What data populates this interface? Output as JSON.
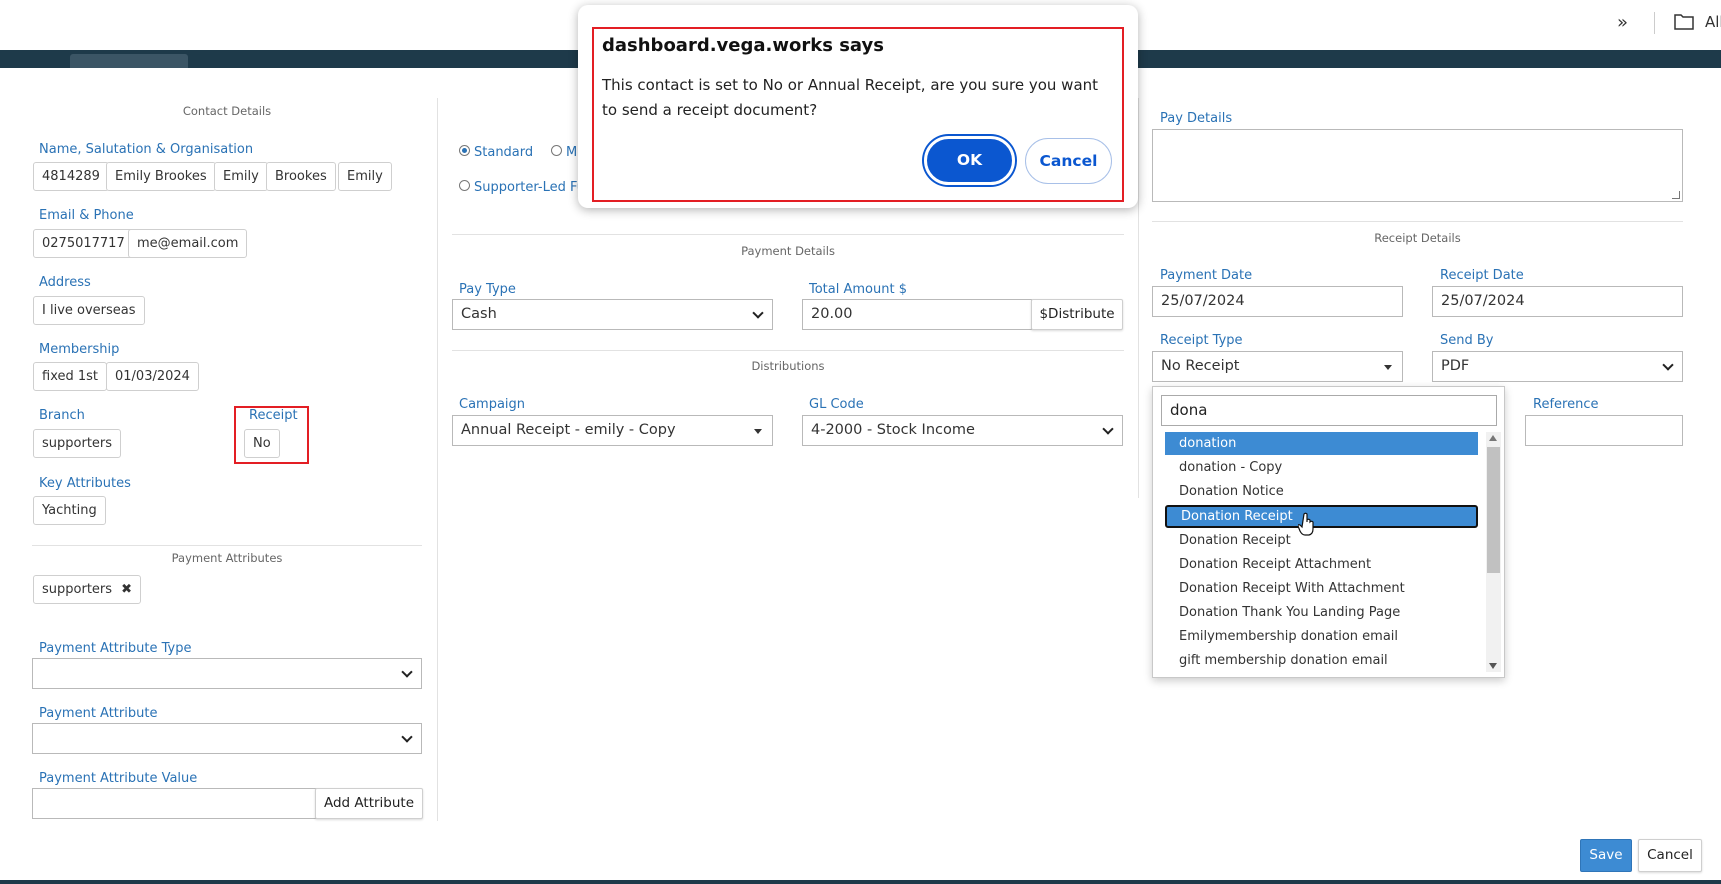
{
  "toolbar": {
    "label": "All"
  },
  "contact": {
    "section_title": "Contact Details",
    "name_label": "Name, Salutation & Organisation",
    "name_chips": [
      "4814289",
      "Emily Brookes",
      "Emily",
      "Brookes",
      "Emily"
    ],
    "email_label": "Email & Phone",
    "phone": "0275017717",
    "email": "me@email.com",
    "address_label": "Address",
    "address": "I live overseas",
    "membership_label": "Membership",
    "membership_type": "fixed 1st",
    "membership_date": "01/03/2024",
    "branch_label": "Branch",
    "branch": "supporters",
    "receipt_label": "Receipt",
    "receipt": "No",
    "key_attr_label": "Key Attributes",
    "key_attr": "Yachting"
  },
  "payment_attributes": {
    "section_title": "Payment Attributes",
    "tag": "supporters",
    "type_label": "Payment Attribute Type",
    "attr_label": "Payment Attribute",
    "value_label": "Payment Attribute Value",
    "add_button": "Add Attribute"
  },
  "payment_mode": {
    "standard": "Standard",
    "m_partial": "M",
    "supporter_led": "Supporter-Led Fu"
  },
  "payment": {
    "section_title": "Payment Details",
    "pay_type_label": "Pay Type",
    "pay_type": "Cash",
    "total_label": "Total Amount $",
    "total": "20.00",
    "distribute_button": "$Distribute"
  },
  "distributions": {
    "section_title": "Distributions",
    "campaign_label": "Campaign",
    "campaign": "Annual Receipt - emily - Copy",
    "gl_label": "GL Code",
    "gl_code": "4-2000 - Stock Income"
  },
  "pay_details": {
    "label": "Pay Details"
  },
  "receipt": {
    "section_title": "Receipt Details",
    "payment_date_label": "Payment Date",
    "payment_date": "25/07/2024",
    "receipt_date_label": "Receipt Date",
    "receipt_date": "25/07/2024",
    "receipt_type_label": "Receipt Type",
    "receipt_type": "No Receipt",
    "send_by_label": "Send By",
    "send_by": "PDF",
    "reference_label": "Reference"
  },
  "dropdown": {
    "search_value": "dona",
    "items": [
      "donation",
      "donation - Copy",
      "Donation Notice",
      "Donation Receipt",
      "Donation Receipt",
      "Donation Receipt Attachment",
      "Donation Receipt With Attachment",
      "Donation Thank You Landing Page",
      "Emilymembership donation email",
      "gift membership donation email"
    ]
  },
  "alert": {
    "title": "dashboard.vega.works says",
    "message": "This contact is set to No or Annual Receipt, are you sure you want to send a receipt document?",
    "ok": "OK",
    "cancel": "Cancel"
  },
  "footer": {
    "save": "Save",
    "cancel": "Cancel"
  },
  "colors": {
    "accent": "#2a72b5",
    "highlight": "#3d8bd3",
    "dialog_button": "#0b57d0",
    "annotation": "#e31e24",
    "header_bar": "#1e3a4a"
  }
}
